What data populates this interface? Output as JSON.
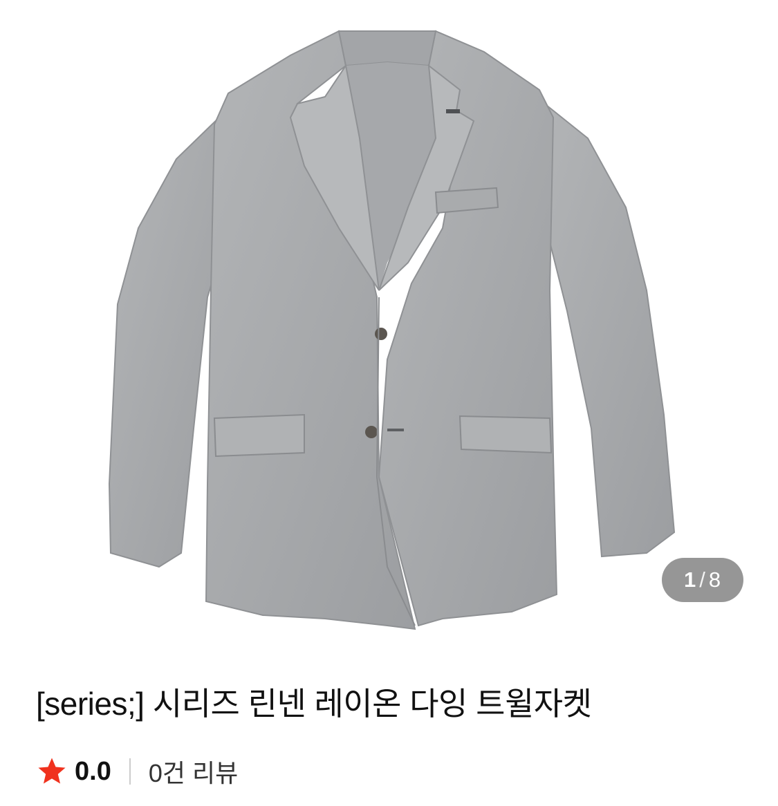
{
  "product": {
    "title": "[series;] 시리즈 린넨 레이온 다잉 트윌자켓",
    "image_alt": "grey twill blazer jacket"
  },
  "gallery": {
    "current": "1",
    "separator": "/",
    "total": "8"
  },
  "rating": {
    "value": "0.0",
    "review_count_label": "0건 리뷰"
  },
  "colors": {
    "star": "#f0321e",
    "jacket": "#a9abad",
    "indicator_bg": "#7a7a7a"
  }
}
